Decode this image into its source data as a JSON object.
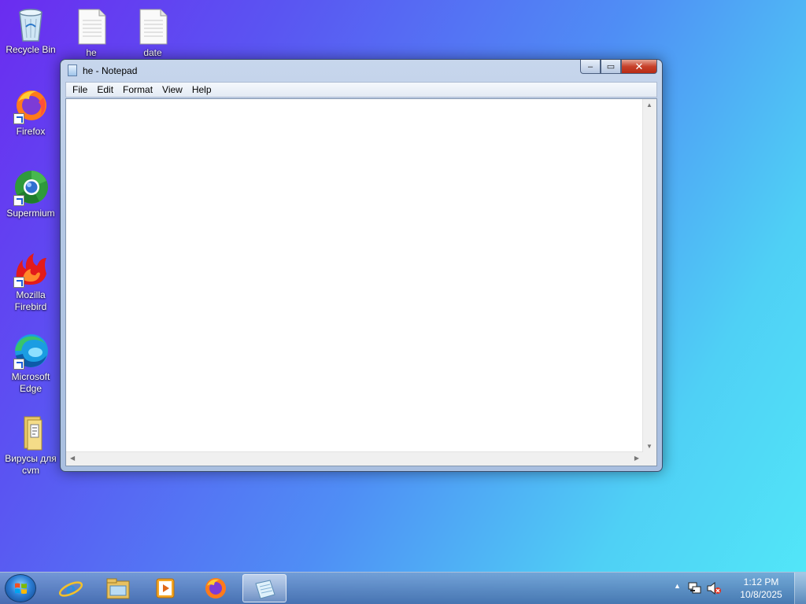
{
  "desktop": {
    "icons": [
      {
        "label": "Recycle Bin"
      },
      {
        "label": "he"
      },
      {
        "label": "date"
      },
      {
        "label": "Firefox"
      },
      {
        "label": "Supermium"
      },
      {
        "label": "Mozilla Firebird"
      },
      {
        "label": "Microsoft Edge"
      },
      {
        "label": "Вирусы для cvm"
      }
    ]
  },
  "notepad": {
    "title": "he - Notepad",
    "menu": [
      "File",
      "Edit",
      "Format",
      "View",
      "Help"
    ],
    "content": "",
    "caption_buttons": {
      "minimize": "–",
      "maximize": "▭",
      "close": "✕"
    }
  },
  "taskbar": {
    "pinned": [
      {
        "icon": "internet-explorer-icon"
      },
      {
        "icon": "file-explorer-icon"
      },
      {
        "icon": "media-player-icon"
      },
      {
        "icon": "firefox-icon"
      },
      {
        "icon": "notepad-icon",
        "active": true
      }
    ],
    "clock": {
      "time": "1:12 PM",
      "date": "10/8/2025"
    }
  },
  "colors": {
    "accent": "#3b6fd0",
    "close_button": "#c7412b"
  }
}
